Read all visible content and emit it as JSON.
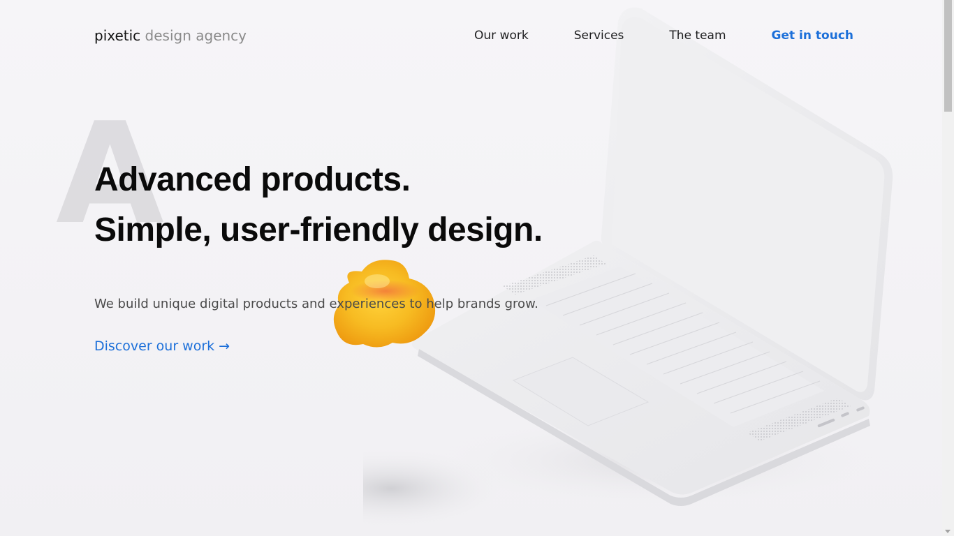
{
  "brand": {
    "name": "pixetic",
    "tagline": "design agency"
  },
  "nav": {
    "items": [
      {
        "label": "Our work"
      },
      {
        "label": "Services"
      },
      {
        "label": "The team"
      }
    ],
    "cta_label": "Get in touch"
  },
  "hero": {
    "background_letter": "A",
    "headline_line1": "Advanced products.",
    "headline_line2": "Simple, user-friendly design.",
    "subtext": "We build unique digital products and experiences to help brands grow.",
    "cta_label": "Discover our work",
    "cta_arrow": "→"
  },
  "colors": {
    "accent": "#1b6fd9",
    "text": "#0a0a0a",
    "muted": "#8a8a8a",
    "background": "#f4f3f6",
    "blob": "#f6b91f"
  },
  "icons": {
    "arrow": "arrow-right-icon",
    "decoration": "yellow-blob-icon",
    "illustration": "laptop-illustration"
  }
}
